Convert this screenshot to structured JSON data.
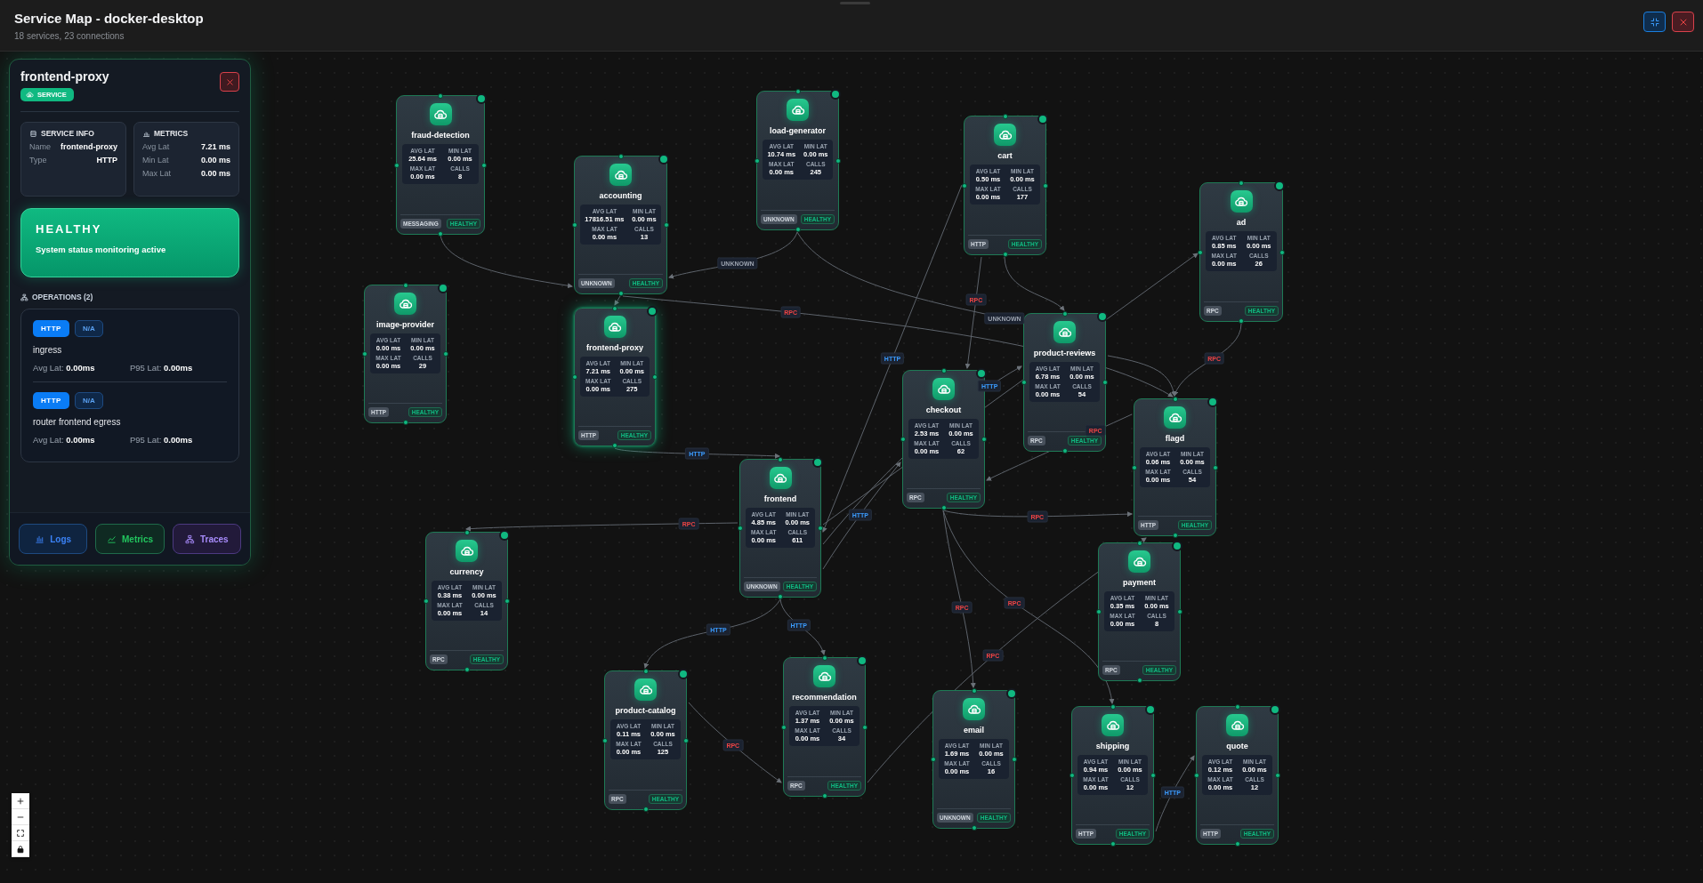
{
  "header": {
    "title": "Service Map - docker-desktop",
    "subtitle": "18 services, 23 connections"
  },
  "detail_panel": {
    "title": "frontend-proxy",
    "badge": "SERVICE",
    "service_info": {
      "heading": "SERVICE INFO",
      "rows": [
        {
          "label": "Name",
          "value": "frontend-proxy"
        },
        {
          "label": "Type",
          "value": "HTTP"
        }
      ]
    },
    "metrics": {
      "heading": "METRICS",
      "rows": [
        {
          "label": "Avg Lat",
          "value": "7.21 ms"
        },
        {
          "label": "Min Lat",
          "value": "0.00 ms"
        },
        {
          "label": "Max Lat",
          "value": "0.00 ms"
        }
      ]
    },
    "health": {
      "status": "HEALTHY",
      "kind": "healthy",
      "message": "System status monitoring active"
    },
    "operations": {
      "heading": "OPERATIONS (2)",
      "items": [
        {
          "protocol": "HTTP",
          "tag": "N/A",
          "name": "ingress",
          "avg": "Avg Lat: **0.00ms**",
          "p95": "P95 Lat: **0.00ms**"
        },
        {
          "protocol": "HTTP",
          "tag": "N/A",
          "name": "router frontend egress",
          "avg": "Avg Lat: **0.00ms**",
          "p95": "P95 Lat: **0.00ms**"
        }
      ]
    },
    "actions": [
      {
        "label": "Logs",
        "kind": "logs"
      },
      {
        "label": "Metrics",
        "kind": "metrics"
      },
      {
        "label": "Traces",
        "kind": "traces"
      }
    ]
  },
  "nodes": [
    {
      "name": "fraud-detection",
      "selected": false,
      "metrics": [
        {
          "label": "AVG LAT",
          "value": "25.64 ms"
        },
        {
          "label": "MIN LAT",
          "value": "0.00 ms"
        },
        {
          "label": "MAX LAT",
          "value": "0.00 ms"
        },
        {
          "label": "CALLS",
          "value": "8"
        }
      ],
      "protocol": "MESSAGING",
      "status": "HEALTHY"
    },
    {
      "name": "load-generator",
      "selected": false,
      "metrics": [
        {
          "label": "AVG LAT",
          "value": "10.74 ms"
        },
        {
          "label": "MIN LAT",
          "value": "0.00 ms"
        },
        {
          "label": "MAX LAT",
          "value": "0.00 ms"
        },
        {
          "label": "CALLS",
          "value": "245"
        }
      ],
      "protocol": "UNKNOWN",
      "status": "HEALTHY"
    },
    {
      "name": "cart",
      "selected": false,
      "metrics": [
        {
          "label": "AVG LAT",
          "value": "0.50 ms"
        },
        {
          "label": "MIN LAT",
          "value": "0.00 ms"
        },
        {
          "label": "MAX LAT",
          "value": "0.00 ms"
        },
        {
          "label": "CALLS",
          "value": "177"
        }
      ],
      "protocol": "HTTP",
      "status": "HEALTHY"
    },
    {
      "name": "accounting",
      "selected": false,
      "metrics": [
        {
          "label": "AVG LAT",
          "value": "17816.51 ms"
        },
        {
          "label": "MIN LAT",
          "value": "0.00 ms"
        },
        {
          "label": "MAX LAT",
          "value": "0.00 ms"
        },
        {
          "label": "CALLS",
          "value": "13"
        }
      ],
      "protocol": "UNKNOWN",
      "status": "HEALTHY"
    },
    {
      "name": "ad",
      "selected": false,
      "metrics": [
        {
          "label": "AVG LAT",
          "value": "0.85 ms"
        },
        {
          "label": "MIN LAT",
          "value": "0.00 ms"
        },
        {
          "label": "MAX LAT",
          "value": "0.00 ms"
        },
        {
          "label": "CALLS",
          "value": "26"
        }
      ],
      "protocol": "RPC",
      "status": "HEALTHY"
    },
    {
      "name": "image-provider",
      "selected": false,
      "metrics": [
        {
          "label": "AVG LAT",
          "value": "0.00 ms"
        },
        {
          "label": "MIN LAT",
          "value": "0.00 ms"
        },
        {
          "label": "MAX LAT",
          "value": "0.00 ms"
        },
        {
          "label": "CALLS",
          "value": "29"
        }
      ],
      "protocol": "HTTP",
      "status": "HEALTHY"
    },
    {
      "name": "frontend-proxy",
      "selected": true,
      "metrics": [
        {
          "label": "AVG LAT",
          "value": "7.21 ms"
        },
        {
          "label": "MIN LAT",
          "value": "0.00 ms"
        },
        {
          "label": "MAX LAT",
          "value": "0.00 ms"
        },
        {
          "label": "CALLS",
          "value": "275"
        }
      ],
      "protocol": "HTTP",
      "status": "HEALTHY"
    },
    {
      "name": "product-reviews",
      "selected": false,
      "metrics": [
        {
          "label": "AVG LAT",
          "value": "6.78 ms"
        },
        {
          "label": "MIN LAT",
          "value": "0.00 ms"
        },
        {
          "label": "MAX LAT",
          "value": "0.00 ms"
        },
        {
          "label": "CALLS",
          "value": "54"
        }
      ],
      "protocol": "RPC",
      "status": "HEALTHY"
    },
    {
      "name": "checkout",
      "selected": false,
      "metrics": [
        {
          "label": "AVG LAT",
          "value": "2.53 ms"
        },
        {
          "label": "MIN LAT",
          "value": "0.00 ms"
        },
        {
          "label": "MAX LAT",
          "value": "0.00 ms"
        },
        {
          "label": "CALLS",
          "value": "62"
        }
      ],
      "protocol": "RPC",
      "status": "HEALTHY"
    },
    {
      "name": "payment",
      "selected": false,
      "metrics": [
        {
          "label": "AVG LAT",
          "value": "0.35 ms"
        },
        {
          "label": "MIN LAT",
          "value": "0.00 ms"
        },
        {
          "label": "MAX LAT",
          "value": "0.00 ms"
        },
        {
          "label": "CALLS",
          "value": "8"
        }
      ],
      "protocol": "RPC",
      "status": "HEALTHY"
    },
    {
      "name": "flagd",
      "selected": false,
      "metrics": [
        {
          "label": "AVG LAT",
          "value": "0.06 ms"
        },
        {
          "label": "MIN LAT",
          "value": "0.00 ms"
        },
        {
          "label": "MAX LAT",
          "value": "0.00 ms"
        },
        {
          "label": "CALLS",
          "value": "54"
        }
      ],
      "protocol": "HTTP",
      "status": "HEALTHY"
    },
    {
      "name": "frontend",
      "selected": false,
      "metrics": [
        {
          "label": "AVG LAT",
          "value": "4.85 ms"
        },
        {
          "label": "MIN LAT",
          "value": "0.00 ms"
        },
        {
          "label": "MAX LAT",
          "value": "0.00 ms"
        },
        {
          "label": "CALLS",
          "value": "611"
        }
      ],
      "protocol": "UNKNOWN",
      "status": "HEALTHY"
    },
    {
      "name": "currency",
      "selected": false,
      "metrics": [
        {
          "label": "AVG LAT",
          "value": "0.38 ms"
        },
        {
          "label": "MIN LAT",
          "value": "0.00 ms"
        },
        {
          "label": "MAX LAT",
          "value": "0.00 ms"
        },
        {
          "label": "CALLS",
          "value": "14"
        }
      ],
      "protocol": "RPC",
      "status": "HEALTHY"
    },
    {
      "name": "product-catalog",
      "selected": false,
      "metrics": [
        {
          "label": "AVG LAT",
          "value": "0.11 ms"
        },
        {
          "label": "MIN LAT",
          "value": "0.00 ms"
        },
        {
          "label": "MAX LAT",
          "value": "0.00 ms"
        },
        {
          "label": "CALLS",
          "value": "125"
        }
      ],
      "protocol": "RPC",
      "status": "HEALTHY"
    },
    {
      "name": "recommendation",
      "selected": false,
      "metrics": [
        {
          "label": "AVG LAT",
          "value": "1.37 ms"
        },
        {
          "label": "MIN LAT",
          "value": "0.00 ms"
        },
        {
          "label": "MAX LAT",
          "value": "0.00 ms"
        },
        {
          "label": "CALLS",
          "value": "34"
        }
      ],
      "protocol": "RPC",
      "status": "HEALTHY"
    },
    {
      "name": "email",
      "selected": false,
      "metrics": [
        {
          "label": "AVG LAT",
          "value": "1.69 ms"
        },
        {
          "label": "MIN LAT",
          "value": "0.00 ms"
        },
        {
          "label": "MAX LAT",
          "value": "0.00 ms"
        },
        {
          "label": "CALLS",
          "value": "16"
        }
      ],
      "protocol": "UNKNOWN",
      "status": "HEALTHY"
    },
    {
      "name": "shipping",
      "selected": false,
      "metrics": [
        {
          "label": "AVG LAT",
          "value": "0.94 ms"
        },
        {
          "label": "MIN LAT",
          "value": "0.00 ms"
        },
        {
          "label": "MAX LAT",
          "value": "0.00 ms"
        },
        {
          "label": "CALLS",
          "value": "12"
        }
      ],
      "protocol": "HTTP",
      "status": "HEALTHY"
    },
    {
      "name": "quote",
      "selected": false,
      "metrics": [
        {
          "label": "AVG LAT",
          "value": "0.12 ms"
        },
        {
          "label": "MIN LAT",
          "value": "0.00 ms"
        },
        {
          "label": "MAX LAT",
          "value": "0.00 ms"
        },
        {
          "label": "CALLS",
          "value": "12"
        }
      ],
      "protocol": "HTTP",
      "status": "HEALTHY"
    }
  ],
  "edge_labels": [
    {
      "text": "UNKNOWN",
      "kind": "unknown"
    },
    {
      "text": "RPC",
      "kind": "rpc"
    },
    {
      "text": "RPC",
      "kind": "rpc"
    },
    {
      "text": "UNKNOWN",
      "kind": "unknown"
    },
    {
      "text": "HTTP",
      "kind": "http"
    },
    {
      "text": "RPC",
      "kind": "rpc"
    },
    {
      "text": "HTTP",
      "kind": "http"
    },
    {
      "text": "RPC",
      "kind": "rpc"
    },
    {
      "text": "HTTP",
      "kind": "http"
    },
    {
      "text": "HTTP",
      "kind": "http"
    },
    {
      "text": "RPC",
      "kind": "rpc"
    },
    {
      "text": "RPC",
      "kind": "rpc"
    },
    {
      "text": "RPC",
      "kind": "rpc"
    },
    {
      "text": "RPC",
      "kind": "rpc"
    },
    {
      "text": "RPC",
      "kind": "rpc"
    },
    {
      "text": "HTTP",
      "kind": "http"
    },
    {
      "text": "HTTP",
      "kind": "http"
    },
    {
      "text": "RPC",
      "kind": "rpc"
    },
    {
      "text": "HTTP",
      "kind": "http"
    }
  ]
}
